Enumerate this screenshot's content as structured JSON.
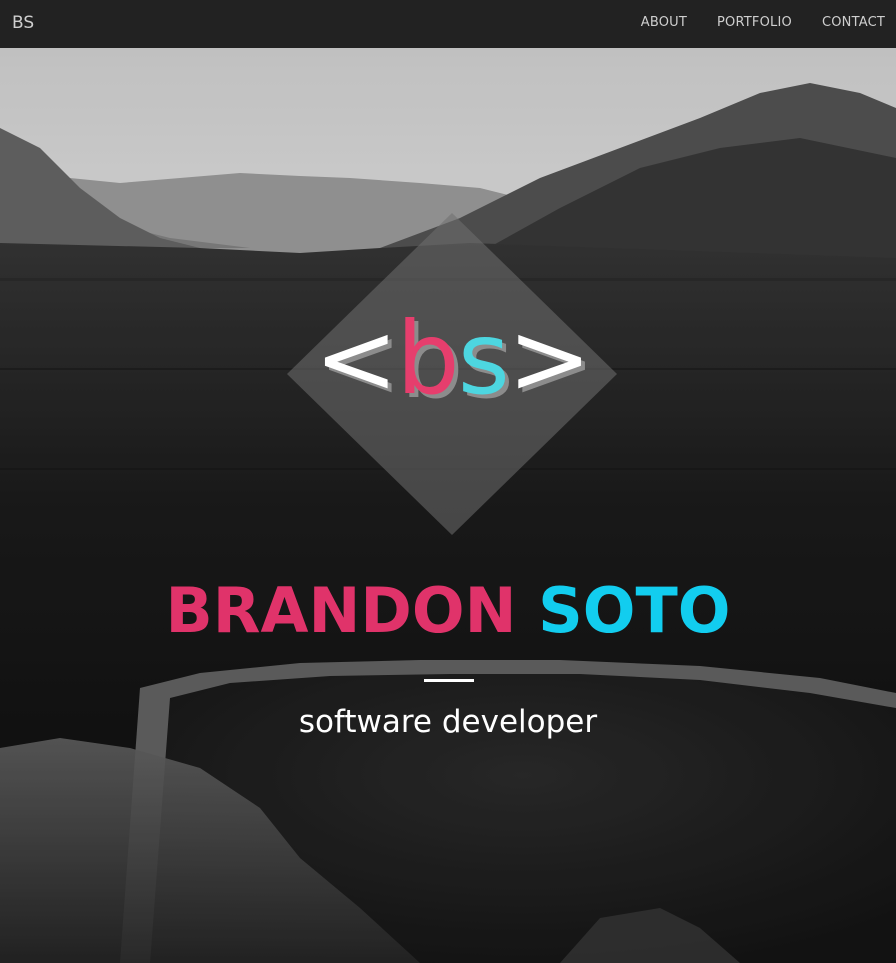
{
  "navbar": {
    "brand": "BS",
    "links": [
      {
        "label": "ABOUT"
      },
      {
        "label": "PORTFOLIO"
      },
      {
        "label": "CONTACT"
      }
    ]
  },
  "hero": {
    "logo": {
      "lt": "<",
      "b": "b",
      "s": "s",
      "gt": ">"
    },
    "first_name": "BRANDON",
    "last_name": "SOTO",
    "tagline": "software developer"
  },
  "colors": {
    "navbar_bg": "#222222",
    "accent_pink": "#e0336a",
    "accent_cyan": "#12cdef"
  }
}
